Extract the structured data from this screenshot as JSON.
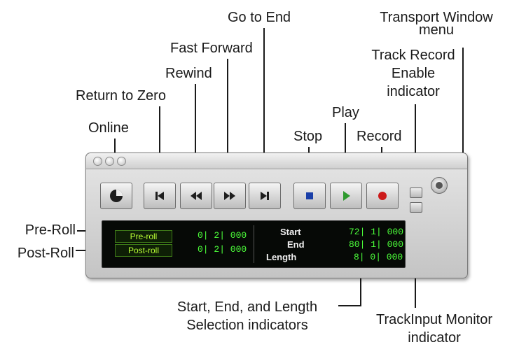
{
  "callouts": {
    "online": "Online",
    "return_to_zero": "Return to Zero",
    "rewind": "Rewind",
    "fast_forward": "Fast Forward",
    "go_to_end": "Go to End",
    "stop": "Stop",
    "play": "Play",
    "record": "Record",
    "transport_menu_line1": "Transport Window",
    "transport_menu_line2": "menu",
    "track_record_line1": "Track Record",
    "track_record_line2": "Enable",
    "track_record_line3": "indicator",
    "pre_roll": "Pre-Roll",
    "post_roll": "Post-Roll",
    "selection_line1": "Start, End, and Length",
    "selection_line2": "Selection indicators",
    "input_monitor_line1": "TrackInput Monitor",
    "input_monitor_line2": "indicator"
  },
  "counter": {
    "pre_roll_label": "Pre-roll",
    "post_roll_label": "Post-roll",
    "pre_roll_value": "0| 2| 000",
    "post_roll_value": "0| 2| 000",
    "start_label": "Start",
    "end_label": "End",
    "length_label": "Length",
    "start_value": "72| 1| 000",
    "end_value": "80| 1| 000",
    "length_value": "8| 0| 000"
  },
  "colors": {
    "counter_text": "#4cff3a",
    "roll_label_text": "#b9ff35",
    "play_icon": "#2e9a2e",
    "record_icon": "#cc1a1a",
    "stop_icon": "#1a3fa8"
  },
  "icons": {
    "online": "online-clock-icon",
    "return_to_zero": "skip-to-start-icon",
    "rewind": "rewind-icon",
    "fast_forward": "fast-forward-icon",
    "go_to_end": "skip-to-end-icon",
    "stop": "stop-icon",
    "play": "play-icon",
    "record": "record-icon"
  }
}
